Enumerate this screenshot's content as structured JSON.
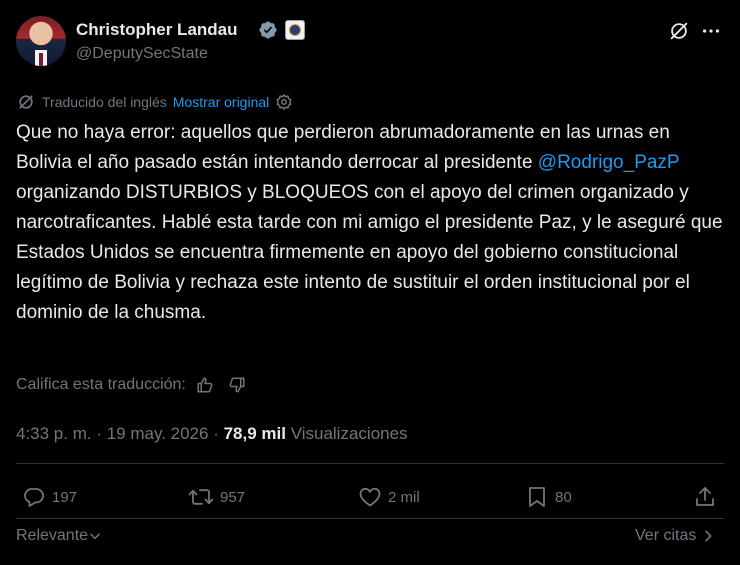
{
  "author": {
    "name": "Christopher Landau",
    "handle": "@DeputySecState"
  },
  "translation": {
    "notice": "Traducido del inglés",
    "show_original": "Mostrar original"
  },
  "tweet": {
    "text_part1": "Que no haya error: aquellos que perdieron abrumadoramente en las urnas en Bolivia el año pasado están intentando derrocar al presidente ",
    "mention": "@Rodrigo_PazP",
    "text_part2": " organizando DISTURBIOS y BLOQUEOS con el apoyo del crimen organizado y narcotraficantes. Hablé esta tarde con mi amigo el presidente Paz, y le aseguré que Estados Unidos se encuentra firmemente en apoyo del gobierno constitucional legítimo de Bolivia y rechaza este intento de sustituir el orden institucional por el dominio de la chusma."
  },
  "rate": {
    "label": "Califica esta traducción:"
  },
  "meta": {
    "time": "4:33 p. m.",
    "separator1": " · ",
    "date": "19 may. 2026",
    "separator2": " · ",
    "views_count": "78,9 mil",
    "views_label": " Visualizaciones"
  },
  "actions": {
    "replies": "197",
    "reposts": "957",
    "likes": "2 mil",
    "bookmarks": "80"
  },
  "footer": {
    "sort_label": "Relevante",
    "quotes_label": "Ver citas"
  },
  "icons": [
    "verified-badge-icon",
    "government-seal-icon",
    "grok-icon",
    "more-icon",
    "translate-icon",
    "settings-icon",
    "thumbs-up-icon",
    "thumbs-down-icon",
    "reply-icon",
    "repost-icon",
    "like-icon",
    "bookmark-icon",
    "share-icon",
    "chevron-down-icon",
    "chevron-right-icon"
  ],
  "colors": {
    "accent": "#1d9bf0",
    "muted": "#71767b",
    "text": "#e7e9ea",
    "background": "#000000"
  }
}
